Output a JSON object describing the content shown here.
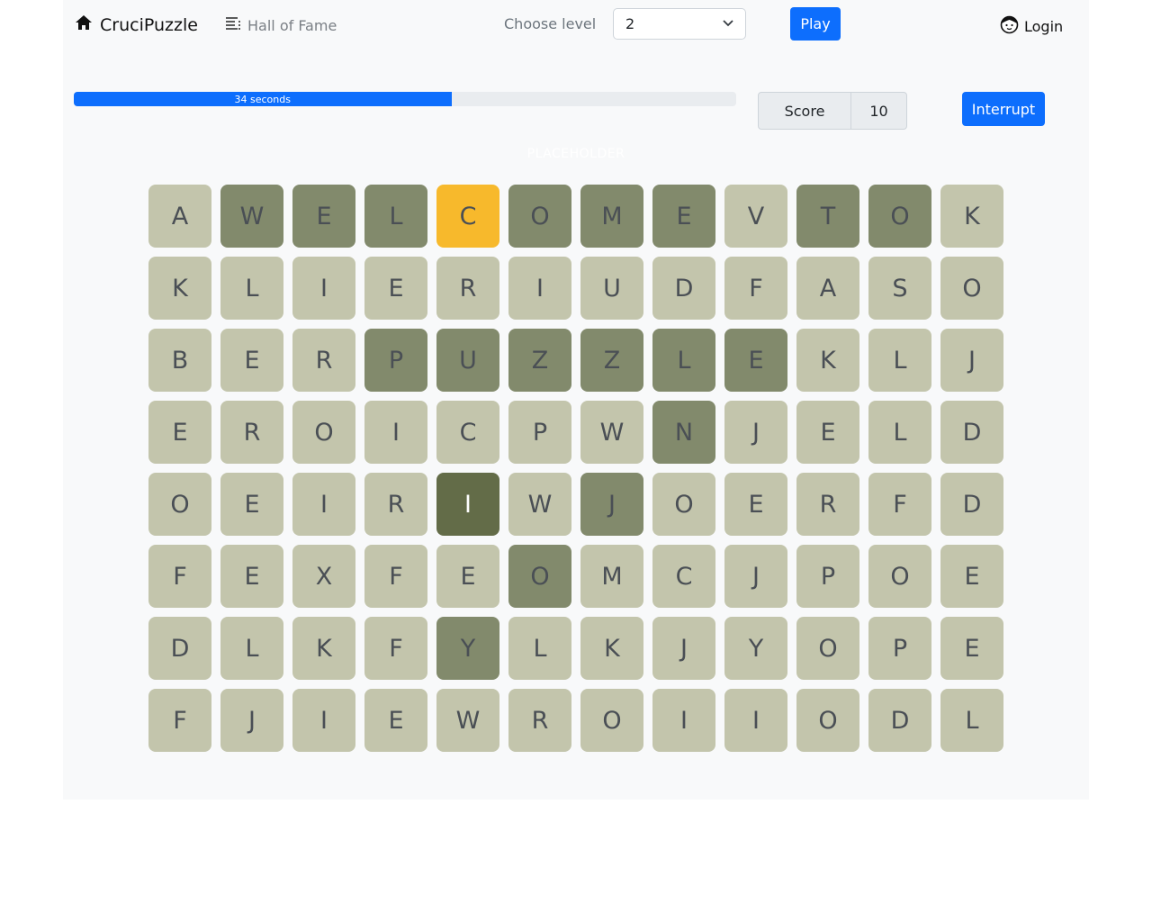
{
  "brand": {
    "name": "CruciPuzzle",
    "icon": "home-icon"
  },
  "nav": {
    "hall_of_fame": "Hall of Fame",
    "hall_icon": "list-icon"
  },
  "level": {
    "label": "Choose level",
    "selected": "2"
  },
  "play_button": "Play",
  "login": {
    "label": "Login",
    "icon": "user-face-icon"
  },
  "timer": {
    "text": "34 seconds",
    "fraction": 0.57
  },
  "score": {
    "label": "Score",
    "value": "10"
  },
  "interrupt_button": "Interrupt",
  "placeholder": "PLACEHOLDER",
  "colors": {
    "accent": "#0d6efd",
    "cell_default": "#c3c5ac",
    "cell_found": "#828a6c",
    "cell_active": "#f7b92c",
    "cell_selected": "#636c48"
  },
  "grid": {
    "rows": [
      [
        "A",
        "W",
        "E",
        "L",
        "C",
        "O",
        "M",
        "E",
        "V",
        "T",
        "O",
        "K"
      ],
      [
        "K",
        "L",
        "I",
        "E",
        "R",
        "I",
        "U",
        "D",
        "F",
        "A",
        "S",
        "O"
      ],
      [
        "B",
        "E",
        "R",
        "P",
        "U",
        "Z",
        "Z",
        "L",
        "E",
        "K",
        "L",
        "J"
      ],
      [
        "E",
        "R",
        "O",
        "I",
        "C",
        "P",
        "W",
        "N",
        "J",
        "E",
        "L",
        "D"
      ],
      [
        "O",
        "E",
        "I",
        "R",
        "I",
        "W",
        "J",
        "O",
        "E",
        "R",
        "F",
        "D"
      ],
      [
        "F",
        "E",
        "X",
        "F",
        "E",
        "O",
        "M",
        "C",
        "J",
        "P",
        "O",
        "E"
      ],
      [
        "D",
        "L",
        "K",
        "F",
        "Y",
        "L",
        "K",
        "J",
        "Y",
        "O",
        "P",
        "E"
      ],
      [
        "F",
        "J",
        "I",
        "E",
        "W",
        "R",
        "O",
        "I",
        "I",
        "O",
        "D",
        "L"
      ]
    ],
    "states": [
      [
        "n",
        "f",
        "f",
        "f",
        "a",
        "f",
        "f",
        "f",
        "n",
        "f",
        "f",
        "n"
      ],
      [
        "n",
        "n",
        "n",
        "n",
        "n",
        "n",
        "n",
        "n",
        "n",
        "n",
        "n",
        "n"
      ],
      [
        "n",
        "n",
        "n",
        "f",
        "f",
        "f",
        "f",
        "f",
        "f",
        "n",
        "n",
        "n"
      ],
      [
        "n",
        "n",
        "n",
        "n",
        "n",
        "n",
        "n",
        "f",
        "n",
        "n",
        "n",
        "n"
      ],
      [
        "n",
        "n",
        "n",
        "n",
        "s",
        "n",
        "f",
        "n",
        "n",
        "n",
        "n",
        "n"
      ],
      [
        "n",
        "n",
        "n",
        "n",
        "n",
        "f",
        "n",
        "n",
        "n",
        "n",
        "n",
        "n"
      ],
      [
        "n",
        "n",
        "n",
        "n",
        "f",
        "n",
        "n",
        "n",
        "n",
        "n",
        "n",
        "n"
      ],
      [
        "n",
        "n",
        "n",
        "n",
        "n",
        "n",
        "n",
        "n",
        "n",
        "n",
        "n",
        "n"
      ]
    ]
  }
}
